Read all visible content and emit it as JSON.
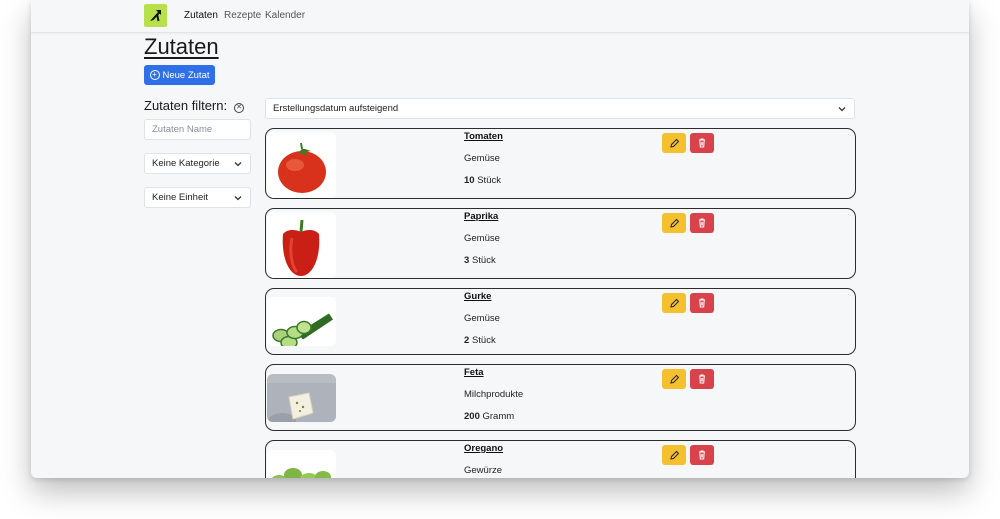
{
  "nav": {
    "links": [
      "Zutaten",
      "Rezepte",
      "Kalender"
    ]
  },
  "page": {
    "title": "Zutaten",
    "new_button": "Neue Zutat"
  },
  "filter": {
    "title": "Zutaten filtern:",
    "name_placeholder": "Zutaten Name",
    "category": "Keine Kategorie",
    "unit": "Keine Einheit",
    "sort": "Erstellungsdatum aufsteigend"
  },
  "items": [
    {
      "name": "Tomaten",
      "category": "Gemüse",
      "amount": "10",
      "unit": "Stück",
      "image": "tomato-image"
    },
    {
      "name": "Paprika",
      "category": "Gemüse",
      "amount": "3",
      "unit": "Stück",
      "image": "paprika-image"
    },
    {
      "name": "Gurke",
      "category": "Gemüse",
      "amount": "2",
      "unit": "Stück",
      "image": "cucumber-image"
    },
    {
      "name": "Feta",
      "category": "Milchprodukte",
      "amount": "200",
      "unit": "Gramm",
      "image": "feta-image"
    },
    {
      "name": "Oregano",
      "category": "Gewürze",
      "amount": "",
      "unit": "",
      "image": "oregano-image"
    }
  ],
  "colors": {
    "accent": "#2f6fe8",
    "logo": "#b7e04b",
    "edit": "#f5c02e",
    "delete": "#d8434b"
  }
}
